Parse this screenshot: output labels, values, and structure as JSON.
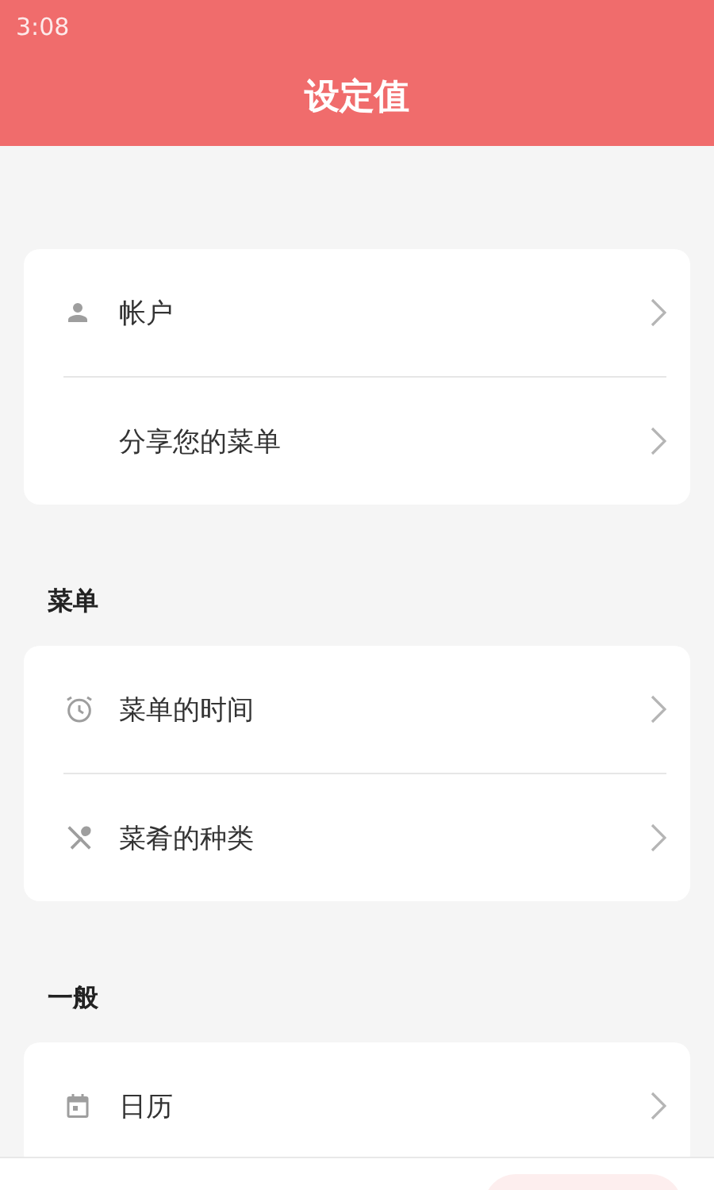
{
  "status_bar": {
    "time": "3:08"
  },
  "header": {
    "title": "设定值"
  },
  "sections": [
    {
      "items": [
        {
          "label": "帐户"
        },
        {
          "label": "分享您的菜单"
        }
      ]
    },
    {
      "title": "菜单",
      "items": [
        {
          "label": "菜单的时间"
        },
        {
          "label": "菜肴的种类"
        }
      ]
    },
    {
      "title": "一般",
      "items": [
        {
          "label": "日历"
        }
      ]
    }
  ]
}
